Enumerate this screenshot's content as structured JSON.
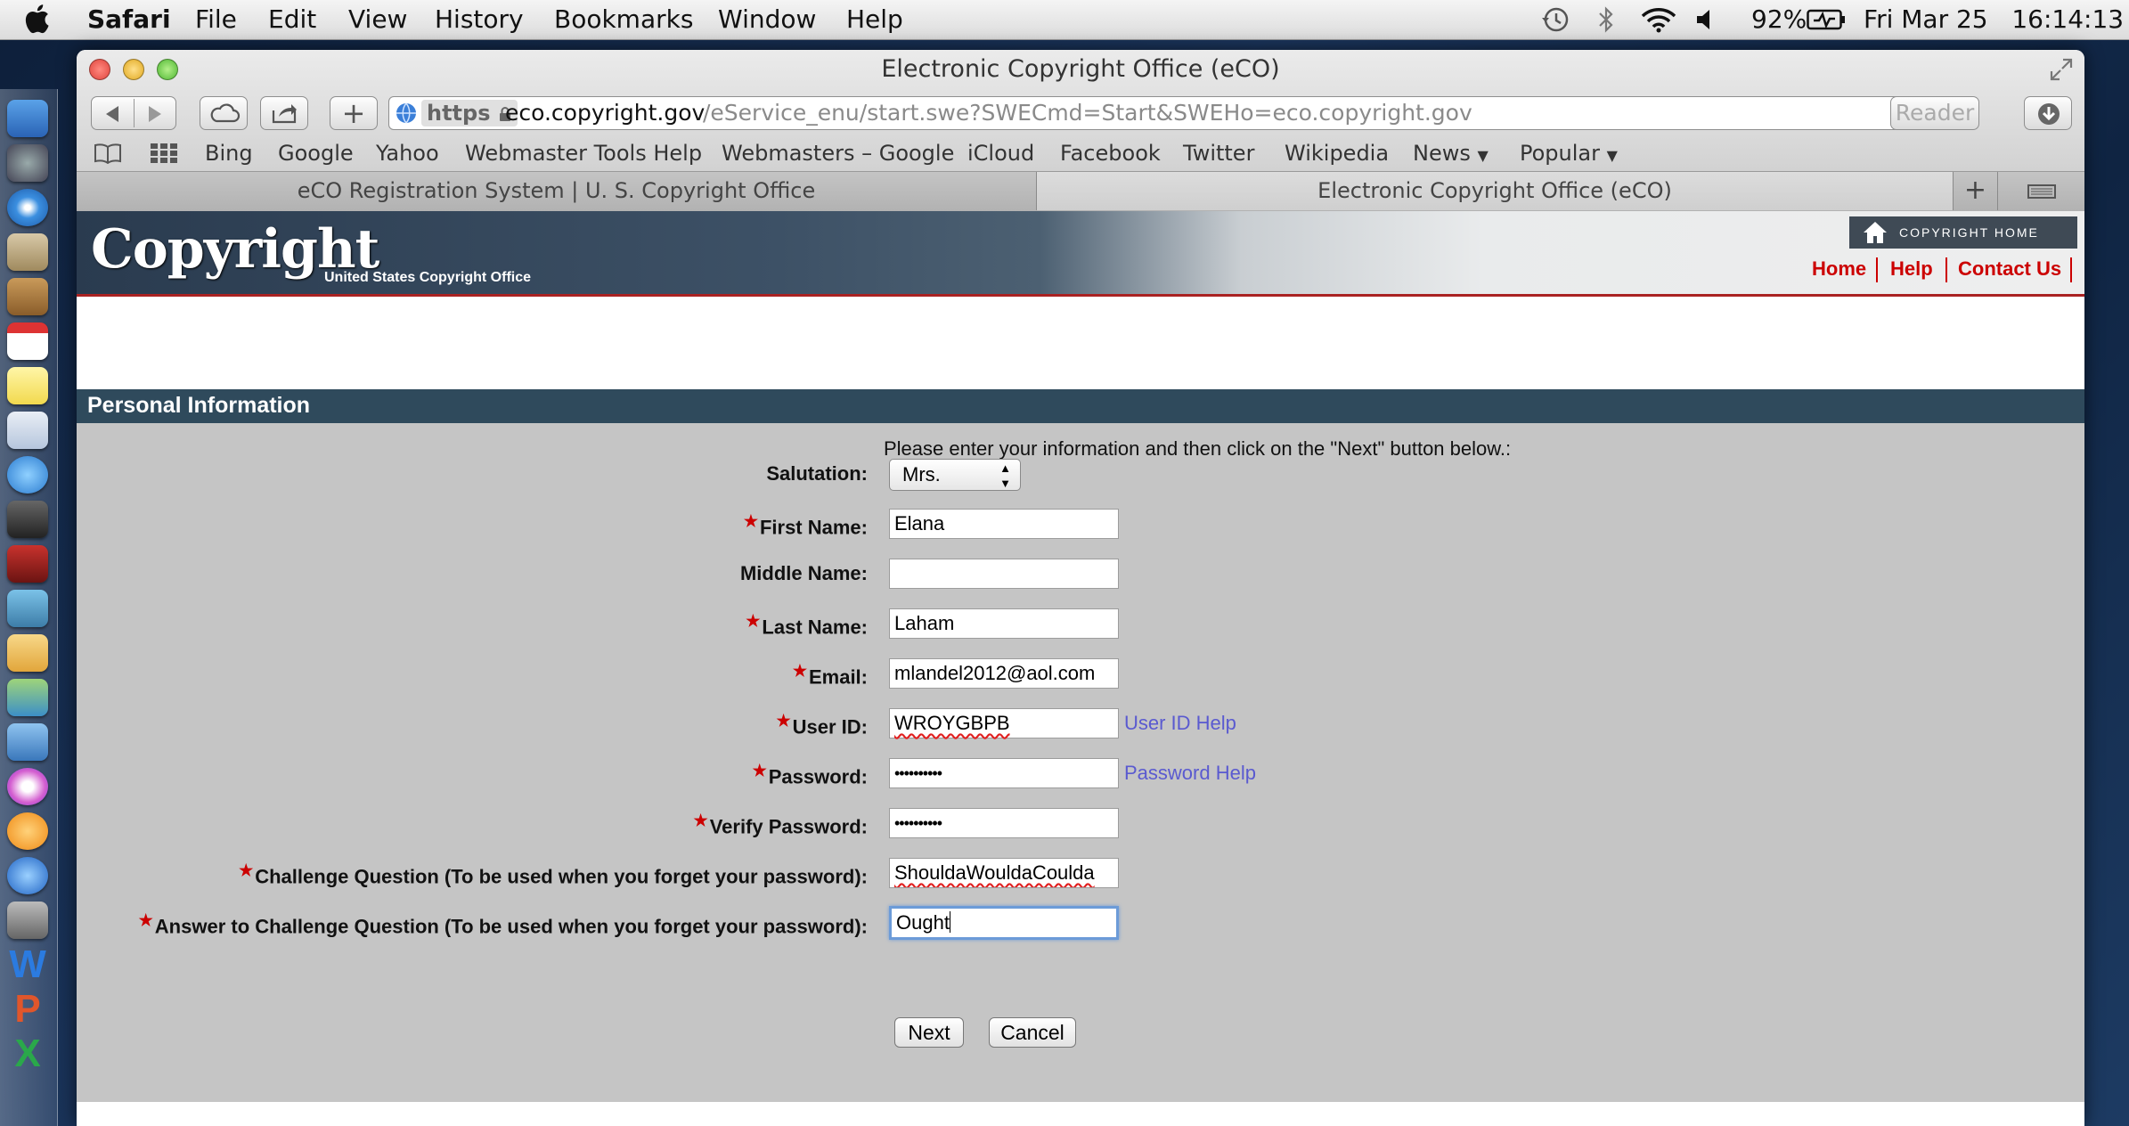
{
  "menubar": {
    "app_name": "Safari",
    "menus": [
      "File",
      "Edit",
      "View",
      "History",
      "Bookmarks",
      "Window",
      "Help"
    ],
    "battery": "92%",
    "datetime": "Fri Mar 25   16:14:13"
  },
  "window": {
    "title": "Electronic Copyright Office (eCO)",
    "url_scheme": "https",
    "url_domain": "eco.copyright.gov",
    "url_path": "/eService_enu/start.swe?SWECmd=Start&SWEHo=eco.copyright.gov",
    "reader_label": "Reader"
  },
  "bookmarks": [
    "Bing",
    "Google",
    "Yahoo",
    "Webmaster Tools Help",
    "Webmasters – Google",
    "iCloud",
    "Facebook",
    "Twitter",
    "Wikipedia",
    "News",
    "Popular"
  ],
  "tabs": [
    {
      "label": "eCO Registration System | U. S. Copyright Office",
      "active": false
    },
    {
      "label": "Electronic Copyright Office (eCO)",
      "active": true
    }
  ],
  "site": {
    "logo": "Copyright",
    "logo_sub": "United States Copyright Office",
    "copyright_home": "COPYRIGHT HOME",
    "nav": [
      "Home",
      "Help",
      "Contact Us"
    ]
  },
  "form": {
    "section_title": "Personal Information",
    "instruction": "Please enter your information and then click on the \"Next\" button below.:",
    "salutation_label": "Salutation:",
    "salutation_value": "Mrs.",
    "first_name_label": "First Name:",
    "first_name_value": "Elana",
    "middle_name_label": "Middle Name:",
    "middle_name_value": "",
    "last_name_label": "Last Name:",
    "last_name_value": "Laham",
    "email_label": "Email:",
    "email_value": "mlandel2012@aol.com",
    "user_id_label": "User ID:",
    "user_id_value": "WROYGBPB",
    "user_id_help": "User ID Help",
    "password_label": "Password:",
    "password_value": "••••••••••",
    "password_help": "Password Help",
    "verify_password_label": "Verify Password:",
    "verify_password_value": "••••••••••",
    "challenge_question_label": "Challenge Question (To be used when you forget your password):",
    "challenge_question_value": "ShouldaWouldaCoulda",
    "challenge_answer_label": "Answer to Challenge Question (To be used when you forget your password):",
    "challenge_answer_value": "Ought",
    "next_label": "Next",
    "cancel_label": "Cancel"
  }
}
